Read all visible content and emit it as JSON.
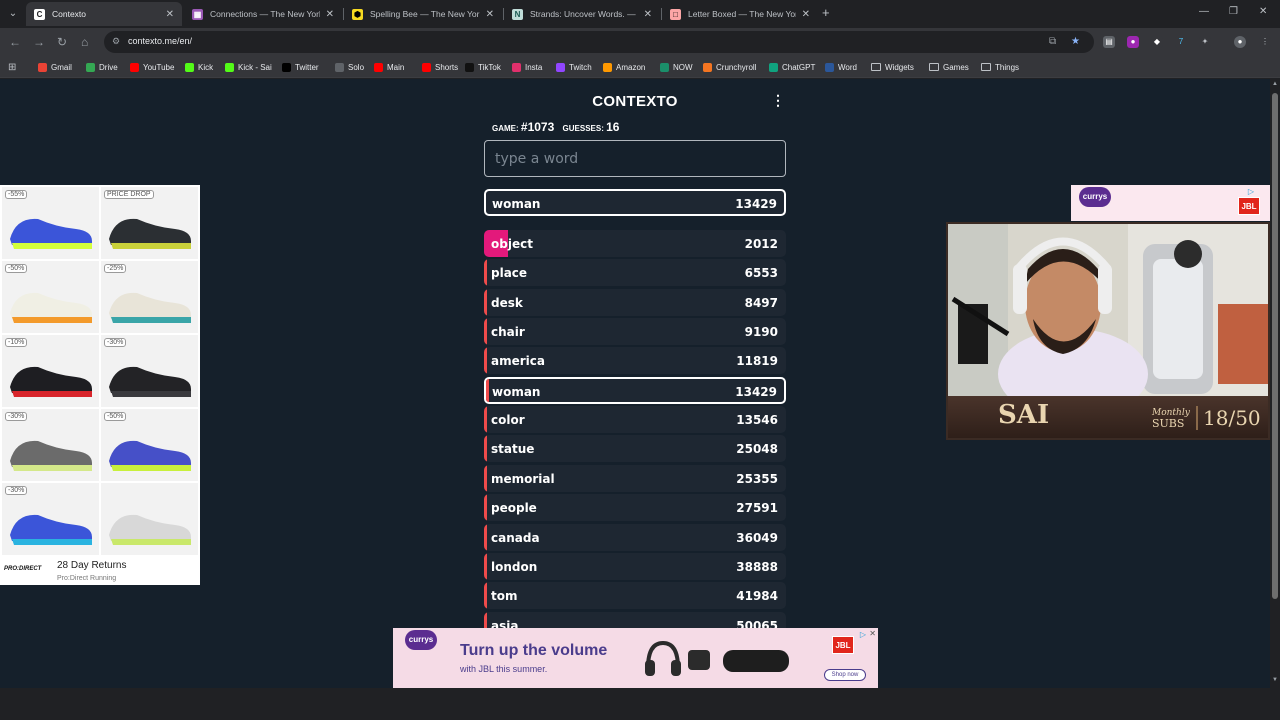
{
  "browser": {
    "tabs": [
      {
        "title": "Contexto",
        "icon": "contexto-icon",
        "active": true
      },
      {
        "title": "Connections — The New York T",
        "icon": "connections-icon",
        "active": false
      },
      {
        "title": "Spelling Bee — The New York T",
        "icon": "spelling-bee-icon",
        "active": false
      },
      {
        "title": "Strands: Uncover Words. — The",
        "icon": "strands-icon",
        "active": false
      },
      {
        "title": "Letter Boxed — The New York T",
        "icon": "letter-boxed-icon",
        "active": false
      }
    ],
    "url": "contexto.me/en/",
    "bookmarks": [
      {
        "label": "Gmail",
        "icon": "gmail-icon",
        "color": "#ea4335"
      },
      {
        "label": "Drive",
        "icon": "drive-icon",
        "color": "#34a853"
      },
      {
        "label": "YouTube",
        "icon": "youtube-icon",
        "color": "#ff0000"
      },
      {
        "label": "Kick",
        "icon": "kick-icon",
        "color": "#53fc18"
      },
      {
        "label": "Kick - Sai",
        "icon": "kick-icon",
        "color": "#53fc18"
      },
      {
        "label": "Twitter",
        "icon": "x-icon",
        "color": "#000000"
      },
      {
        "label": "Solo",
        "icon": "globe-icon",
        "color": "#5f6368"
      },
      {
        "label": "Main",
        "icon": "youtube-icon",
        "color": "#ff0000"
      },
      {
        "label": "Shorts",
        "icon": "youtube-icon",
        "color": "#ff0000"
      },
      {
        "label": "TikTok",
        "icon": "tiktok-icon",
        "color": "#111111"
      },
      {
        "label": "Insta",
        "icon": "instagram-icon",
        "color": "#e1306c"
      },
      {
        "label": "Twitch",
        "icon": "twitch-icon",
        "color": "#9146ff"
      },
      {
        "label": "Amazon",
        "icon": "amazon-icon",
        "color": "#ff9900"
      },
      {
        "label": "NOW",
        "icon": "now-icon",
        "color": "#1b8f6a"
      },
      {
        "label": "Crunchyroll",
        "icon": "crunchyroll-icon",
        "color": "#f47521"
      },
      {
        "label": "ChatGPT",
        "icon": "chatgpt-icon",
        "color": "#10a37f"
      },
      {
        "label": "Word",
        "icon": "word-icon",
        "color": "#2b579a"
      },
      {
        "label": "Widgets",
        "icon": "folder-icon",
        "color": "#bdc1c6"
      },
      {
        "label": "Games",
        "icon": "folder-icon",
        "color": "#bdc1c6"
      },
      {
        "label": "Things",
        "icon": "folder-icon",
        "color": "#bdc1c6"
      }
    ]
  },
  "game": {
    "logo": "CONTEXTO",
    "game_label": "GAME:",
    "game_number": "#1073",
    "guesses_label": "GUESSES:",
    "guesses_count": "16",
    "input_placeholder": "type a word",
    "last_guess": {
      "word": "woman",
      "rank": "13429"
    },
    "guesses": [
      {
        "word": "object",
        "rank": "2012",
        "fill": 0.08,
        "fill_color": "#e3197b"
      },
      {
        "word": "place",
        "rank": "6553",
        "fill": 0.01,
        "fill_color": "#ef4b4b"
      },
      {
        "word": "desk",
        "rank": "8497",
        "fill": 0.01,
        "fill_color": "#ef4b4b"
      },
      {
        "word": "chair",
        "rank": "9190",
        "fill": 0.01,
        "fill_color": "#ef4b4b"
      },
      {
        "word": "america",
        "rank": "11819",
        "fill": 0.01,
        "fill_color": "#ef4b4b"
      },
      {
        "word": "woman",
        "rank": "13429",
        "fill": 0.01,
        "fill_color": "#ef4b4b",
        "highlight": true
      },
      {
        "word": "color",
        "rank": "13546",
        "fill": 0.01,
        "fill_color": "#ef4b4b"
      },
      {
        "word": "statue",
        "rank": "25048",
        "fill": 0.01,
        "fill_color": "#ef4b4b"
      },
      {
        "word": "memorial",
        "rank": "25355",
        "fill": 0.01,
        "fill_color": "#ef4b4b"
      },
      {
        "word": "people",
        "rank": "27591",
        "fill": 0.01,
        "fill_color": "#ef4b4b"
      },
      {
        "word": "canada",
        "rank": "36049",
        "fill": 0.01,
        "fill_color": "#ef4b4b"
      },
      {
        "word": "london",
        "rank": "38888",
        "fill": 0.01,
        "fill_color": "#ef4b4b"
      },
      {
        "word": "tom",
        "rank": "41984",
        "fill": 0.01,
        "fill_color": "#ef4b4b"
      },
      {
        "word": "asia",
        "rank": "50065",
        "fill": 0.01,
        "fill_color": "#ef4b4b"
      }
    ]
  },
  "ad_left": {
    "badges": [
      "-55%",
      "PRICE DROP",
      "-50%",
      "-25%",
      "-10%",
      "-30%",
      "-30%",
      "-50%",
      "-30%",
      ""
    ],
    "brand": "PRO:DIRECT",
    "headline": "28 Day Returns",
    "sub": "Pro:Direct Running"
  },
  "ad_right": {
    "brand": "currys",
    "jbl": "JBL"
  },
  "webcam": {
    "name": "SAI",
    "monthly": "Monthly",
    "subs": "SUBS",
    "count": "18/50"
  },
  "ad_bottom": {
    "brand": "currys",
    "headline": "Turn up the volume",
    "sub": "with JBL this summer.",
    "jbl": "JBL",
    "cta": "Shop now"
  }
}
